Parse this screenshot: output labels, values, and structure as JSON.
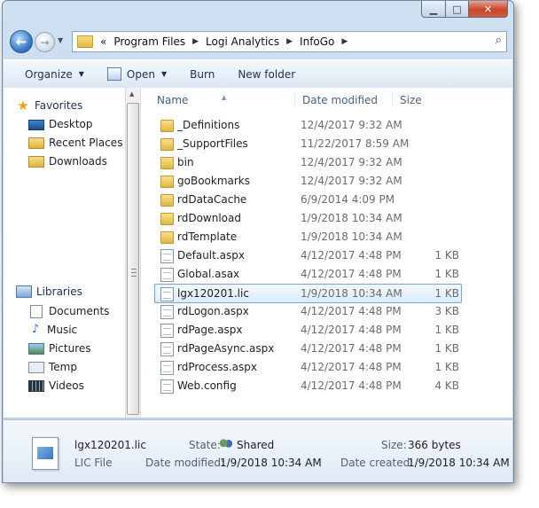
{
  "window": {
    "minimize_glyph": "▁",
    "maximize_glyph": "□",
    "close_glyph": "✕"
  },
  "nav": {
    "back_glyph": "←",
    "forward_glyph": "→",
    "recent_glyph": "▼",
    "overflow": "«",
    "breadcrumb": [
      "Program Files",
      "Logi Analytics",
      "InfoGo"
    ],
    "search_glyph": "⌕"
  },
  "toolbar": {
    "organize": "Organize",
    "open": "Open",
    "burn": "Burn",
    "new_folder": "New folder"
  },
  "sidebar": {
    "favorites_label": "Favorites",
    "favorites": [
      {
        "label": "Desktop",
        "icon": "desktop-icon"
      },
      {
        "label": "Recent Places",
        "icon": "recent-places-icon"
      },
      {
        "label": "Downloads",
        "icon": "downloads-icon"
      }
    ],
    "libraries_label": "Libraries",
    "libraries": [
      {
        "label": "Documents",
        "icon": "documents-icon"
      },
      {
        "label": "Music",
        "icon": "music-icon"
      },
      {
        "label": "Pictures",
        "icon": "pictures-icon"
      },
      {
        "label": "Temp",
        "icon": "temp-icon"
      },
      {
        "label": "Videos",
        "icon": "videos-icon"
      }
    ]
  },
  "columns": {
    "name": "Name",
    "date": "Date modified",
    "size": "Size"
  },
  "files": [
    {
      "name": "_Definitions",
      "date": "12/4/2017 9:32 AM",
      "size": "",
      "type": "folder"
    },
    {
      "name": "_SupportFiles",
      "date": "11/22/2017 8:59 AM",
      "size": "",
      "type": "folder"
    },
    {
      "name": "bin",
      "date": "12/4/2017 9:32 AM",
      "size": "",
      "type": "folder"
    },
    {
      "name": "goBookmarks",
      "date": "12/4/2017 9:32 AM",
      "size": "",
      "type": "folder"
    },
    {
      "name": "rdDataCache",
      "date": "6/9/2014 4:09 PM",
      "size": "",
      "type": "folder"
    },
    {
      "name": "rdDownload",
      "date": "1/9/2018 10:34 AM",
      "size": "",
      "type": "folder"
    },
    {
      "name": "rdTemplate",
      "date": "1/9/2018 10:34 AM",
      "size": "",
      "type": "folder"
    },
    {
      "name": "Default.aspx",
      "date": "4/12/2017 4:48 PM",
      "size": "1 KB",
      "type": "file"
    },
    {
      "name": "Global.asax",
      "date": "4/12/2017 4:48 PM",
      "size": "1 KB",
      "type": "file"
    },
    {
      "name": "lgx120201.lic",
      "date": "1/9/2018 10:34 AM",
      "size": "1 KB",
      "type": "file",
      "selected": true
    },
    {
      "name": "rdLogon.aspx",
      "date": "4/12/2017 4:48 PM",
      "size": "3 KB",
      "type": "file"
    },
    {
      "name": "rdPage.aspx",
      "date": "4/12/2017 4:48 PM",
      "size": "1 KB",
      "type": "file"
    },
    {
      "name": "rdPageAsync.aspx",
      "date": "4/12/2017 4:48 PM",
      "size": "1 KB",
      "type": "file"
    },
    {
      "name": "rdProcess.aspx",
      "date": "4/12/2017 4:48 PM",
      "size": "1 KB",
      "type": "file"
    },
    {
      "name": "Web.config",
      "date": "4/12/2017 4:48 PM",
      "size": "4 KB",
      "type": "file"
    }
  ],
  "details": {
    "filename": "lgx120201.lic",
    "filetype": "LIC File",
    "state_label": "State:",
    "state_value": "Shared",
    "size_label": "Size:",
    "size_value": "366 bytes",
    "modified_label": "Date modified:",
    "modified_value": "1/9/2018 10:34 AM",
    "created_label": "Date created:",
    "created_value": "1/9/2018 10:34 AM"
  }
}
